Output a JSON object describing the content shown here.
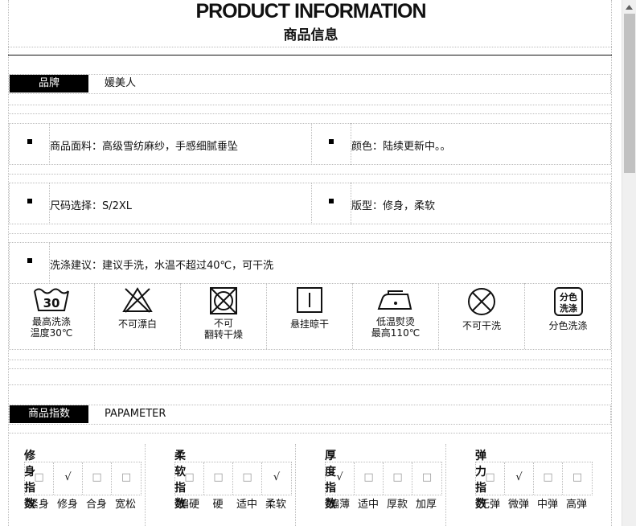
{
  "header": {
    "title_en": "PRODUCT INFORMATION",
    "title_cn": "商品信息"
  },
  "brand": {
    "label": "品牌",
    "value": "媛美人"
  },
  "details": {
    "fabric": "商品面料：高级雪纺麻纱，手感细腻垂坠",
    "color": "颜色：陆续更新中。。",
    "size": "尺码选择：S/2XL",
    "fit": "版型：修身，柔软",
    "wash": "洗涤建议：建议手洗，水温不超过40℃，可干洗"
  },
  "care_icons": [
    {
      "icon": "wash-30-icon",
      "badge": "30",
      "line1": "最高洗涤",
      "line2": "温度30℃"
    },
    {
      "icon": "no-bleach-icon",
      "line1": "不可漂白",
      "line2": ""
    },
    {
      "icon": "no-tumble-dry-icon",
      "line1": "不可",
      "line2": "翻转干燥"
    },
    {
      "icon": "hang-dry-icon",
      "line1": "悬挂晾干",
      "line2": ""
    },
    {
      "icon": "low-iron-icon",
      "line1": "低温熨烫",
      "line2": "最高110℃"
    },
    {
      "icon": "no-dry-clean-icon",
      "line1": "不可干洗",
      "line2": ""
    },
    {
      "icon": "separate-wash-icon",
      "badge": "分色洗涤",
      "line1": "分色洗涤",
      "line2": ""
    }
  ],
  "params": {
    "label": "商品指数",
    "value": "PAPAMETER"
  },
  "indices": [
    {
      "title": "修身指数",
      "marks": [
        "□",
        "√",
        "□",
        "□"
      ],
      "selected": 1,
      "options": [
        "紧身",
        "修身",
        "合身",
        "宽松"
      ]
    },
    {
      "title": "柔软指数",
      "marks": [
        "□",
        "□",
        "□",
        "√"
      ],
      "selected": 3,
      "options": [
        "偏硬",
        "硬",
        "适中",
        "柔软"
      ]
    },
    {
      "title": "厚度指数",
      "marks": [
        "√",
        "□",
        "□",
        "□"
      ],
      "selected": 0,
      "options": [
        "偏薄",
        "适中",
        "厚款",
        "加厚"
      ]
    },
    {
      "title": "弹力指数",
      "marks": [
        "□",
        "√",
        "□",
        "□"
      ],
      "selected": 1,
      "options": [
        "无弹",
        "微弹",
        "中弹",
        "高弹"
      ]
    }
  ]
}
